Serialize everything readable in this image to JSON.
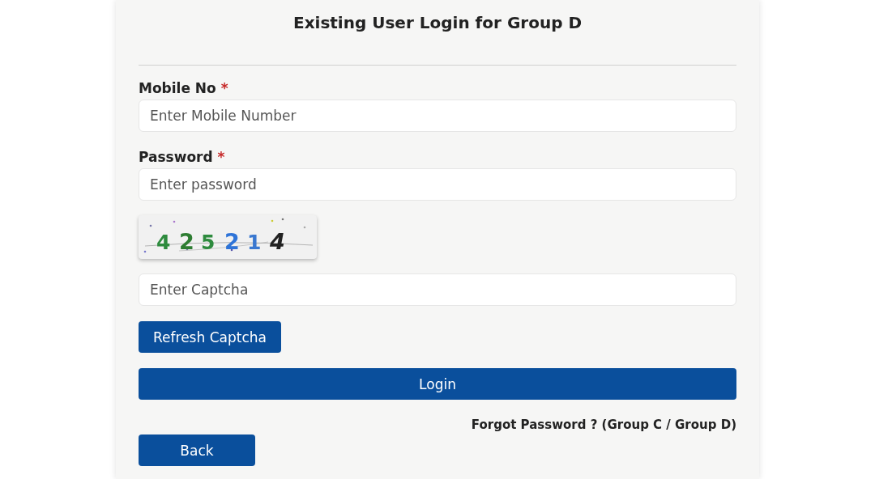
{
  "title": "Existing User Login for Group D",
  "fields": [
    {
      "label": "Mobile No",
      "required_mark": "*",
      "placeholder": "Enter Mobile Number"
    },
    {
      "label": "Password",
      "required_mark": "*",
      "placeholder": "Enter password"
    }
  ],
  "captcha": {
    "characters": [
      {
        "char": "4",
        "color": "#2e8b3e"
      },
      {
        "char": "2",
        "color": "#2e7d32"
      },
      {
        "char": "5",
        "color": "#2e8b3e"
      },
      {
        "char": "2",
        "color": "#2f74d8"
      },
      {
        "char": "1",
        "color": "#3a78d0"
      },
      {
        "char": "4",
        "color": "#222222"
      }
    ],
    "placeholder": "Enter Captcha"
  },
  "refresh_button": "Refresh Captcha",
  "login_button": "Login",
  "forgot_link": "Forgot Password ? (Group C / Group D)",
  "back_button": "Back"
}
